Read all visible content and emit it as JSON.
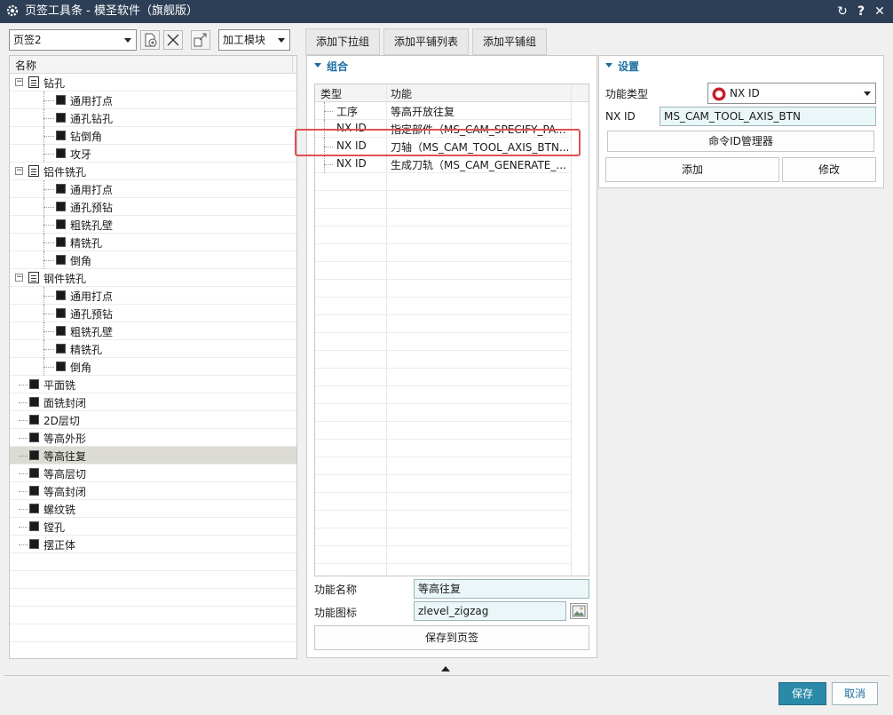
{
  "window": {
    "title": "页签工具条 - 模圣软件（旗舰版）",
    "icons": [
      "gear-icon",
      "refresh-icon",
      "help-icon",
      "close-icon"
    ]
  },
  "toolbar": {
    "tab_combo_value": "页签2",
    "icons": [
      "add-tab-icon",
      "delete-icon",
      "export-icon"
    ],
    "module_combo_value": "加工模块",
    "add_dropdown_group": "添加下拉组",
    "add_tile_list": "添加平铺列表",
    "add_tile_group": "添加平铺组"
  },
  "tree": {
    "header": "名称",
    "items": [
      {
        "label": "钻孔",
        "level": 0,
        "type": "group"
      },
      {
        "label": "通用打点",
        "level": 1,
        "type": "leaf"
      },
      {
        "label": "通孔钻孔",
        "level": 1,
        "type": "leaf"
      },
      {
        "label": "钻倒角",
        "level": 1,
        "type": "leaf"
      },
      {
        "label": "攻牙",
        "level": 1,
        "type": "leaf"
      },
      {
        "label": "铝件铣孔",
        "level": 0,
        "type": "group"
      },
      {
        "label": "通用打点",
        "level": 1,
        "type": "leaf"
      },
      {
        "label": "通孔预钻",
        "level": 1,
        "type": "leaf"
      },
      {
        "label": "粗铣孔壁",
        "level": 1,
        "type": "leaf"
      },
      {
        "label": "精铣孔",
        "level": 1,
        "type": "leaf"
      },
      {
        "label": "倒角",
        "level": 1,
        "type": "leaf"
      },
      {
        "label": "钢件铣孔",
        "level": 0,
        "type": "group"
      },
      {
        "label": "通用打点",
        "level": 1,
        "type": "leaf"
      },
      {
        "label": "通孔预钻",
        "level": 1,
        "type": "leaf"
      },
      {
        "label": "粗铣孔壁",
        "level": 1,
        "type": "leaf"
      },
      {
        "label": "精铣孔",
        "level": 1,
        "type": "leaf"
      },
      {
        "label": "倒角",
        "level": 1,
        "type": "leaf"
      },
      {
        "label": "平面铣",
        "level": 0,
        "type": "item"
      },
      {
        "label": "面铣封闭",
        "level": 0,
        "type": "item"
      },
      {
        "label": "2D层切",
        "level": 0,
        "type": "item"
      },
      {
        "label": "等高外形",
        "level": 0,
        "type": "item"
      },
      {
        "label": "等高往复",
        "level": 0,
        "type": "item",
        "selected": true
      },
      {
        "label": "等高层切",
        "level": 0,
        "type": "item"
      },
      {
        "label": "等高封闭",
        "level": 0,
        "type": "item"
      },
      {
        "label": "螺纹铣",
        "level": 0,
        "type": "item"
      },
      {
        "label": "镗孔",
        "level": 0,
        "type": "item"
      },
      {
        "label": "摆正体",
        "level": 0,
        "type": "item"
      }
    ]
  },
  "combo_panel": {
    "title": "组合",
    "col_type": "类型",
    "col_function": "功能",
    "rows": [
      {
        "type": "工序",
        "function": "等高开放往复"
      },
      {
        "type": "NX ID",
        "function": "指定部件（MS_CAM_SPECIFY_PA..."
      },
      {
        "type": "NX ID",
        "function": "刀轴（MS_CAM_TOOL_AXIS_BTN...",
        "highlighted": true
      },
      {
        "type": "NX ID",
        "function": "生成刀轨（MS_CAM_GENERATE_..."
      }
    ],
    "function_name_label": "功能名称",
    "function_name_value": "等高往复",
    "function_icon_label": "功能图标",
    "function_icon_value": "zlevel_zigzag",
    "save_button": "保存到页签"
  },
  "settings_panel": {
    "title": "设置",
    "function_type_label": "功能类型",
    "function_type_value": "NX ID",
    "nx_id_label": "NX ID",
    "nx_id_value": "MS_CAM_TOOL_AXIS_BTN",
    "cmd_manager_button": "命令ID管理器",
    "add_button": "添加",
    "modify_button": "修改"
  },
  "footer": {
    "save": "保存",
    "cancel": "取消"
  },
  "colors": {
    "titlebar": "#2d3f56",
    "accent": "#1a6fa0",
    "primary_button": "#2a8aa8",
    "highlight_box": "#e05050"
  }
}
